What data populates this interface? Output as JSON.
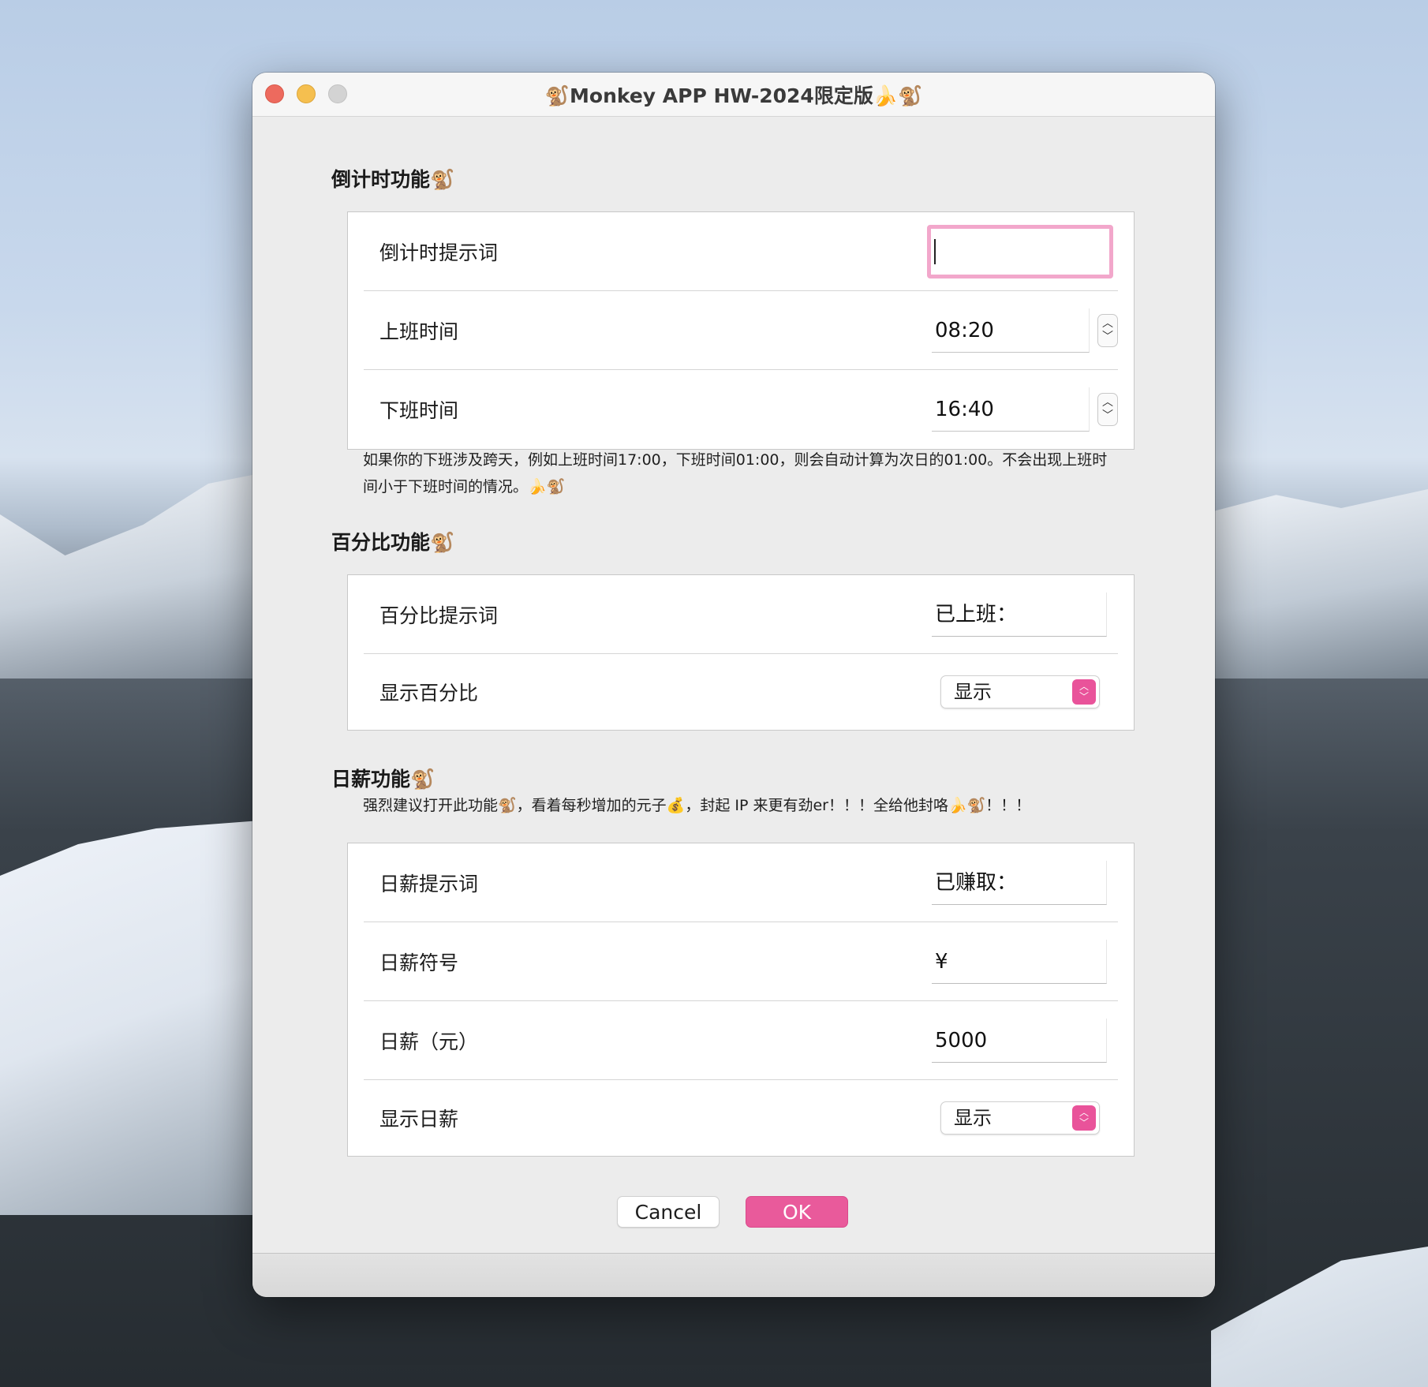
{
  "window": {
    "title": "🐒Monkey APP HW-2024限定版🍌🐒"
  },
  "countdown": {
    "heading": "倒计时功能🐒",
    "prompt_label": "倒计时提示词",
    "prompt_value": "",
    "start_label": "上班时间",
    "start_value": "08:20",
    "end_label": "下班时间",
    "end_value": "16:40",
    "note_line1": "如果你的下班涉及跨天，例如上班时间17:00，下班时间01:00，则会自动计算为次日的01:00。不会出现上班时",
    "note_line2": "间小于下班时间的情况。🍌🐒"
  },
  "percent": {
    "heading": "百分比功能🐒",
    "prompt_label": "百分比提示词",
    "prompt_value": "已上班：",
    "show_label": "显示百分比",
    "show_value": "显示"
  },
  "salary": {
    "heading": "日薪功能🐒",
    "note": "强烈建议打开此功能🐒，看着每秒增加的元子💰，封起 IP 来更有劲er！！！全给他封咯🍌🐒！！！",
    "prompt_label": "日薪提示词",
    "prompt_value": "已赚取：",
    "symbol_label": "日薪符号",
    "symbol_value": "¥",
    "amount_label": "日薪（元）",
    "amount_value": "5000",
    "show_label": "显示日薪",
    "show_value": "显示"
  },
  "buttons": {
    "cancel": "Cancel",
    "ok": "OK"
  }
}
